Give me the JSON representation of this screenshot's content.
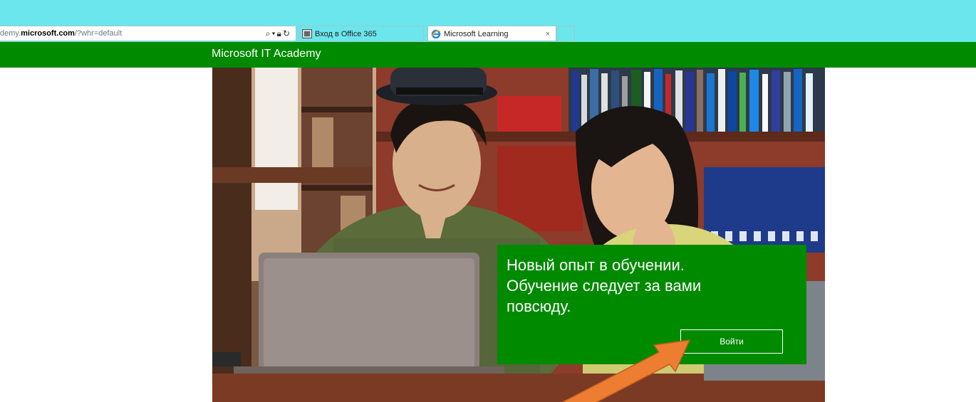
{
  "browser": {
    "address_prefix": "demy.",
    "address_host": "microsoft.com",
    "address_path": "/?whr=default",
    "tabs": [
      {
        "label": "Вход в Office 365"
      },
      {
        "label": "Microsoft Learning",
        "close": "×"
      }
    ],
    "icons": [
      "search-icon",
      "dropdown-icon",
      "lock-icon",
      "refresh-icon"
    ]
  },
  "header": {
    "brand": "Microsoft IT Academy"
  },
  "hero": {
    "image": "students-with-laptop-photo"
  },
  "promo": {
    "line1": "Новый опыт в обучении.",
    "line2": "Обучение следует за вами",
    "line3": "повсюду.",
    "login_label": "Войти"
  },
  "colors": {
    "brand_green": "#008a00",
    "chrome": "#6be6ec",
    "arrow": "#ed7d31"
  }
}
